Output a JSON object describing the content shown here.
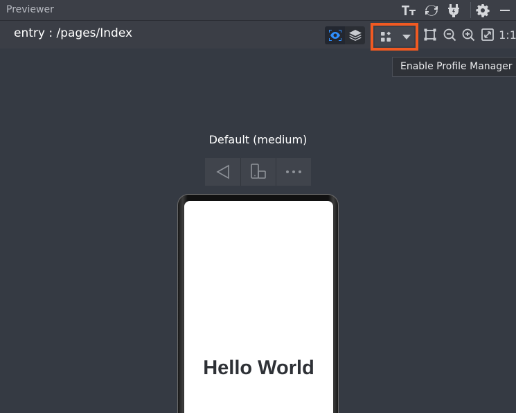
{
  "window": {
    "title": "Previewer"
  },
  "titlebar_icons": [
    "font-size-icon",
    "refresh-icon",
    "plug-icon",
    "gear-icon",
    "minimize-icon"
  ],
  "toolbar": {
    "path": "entry : /pages/Index",
    "view_toggle": [
      "eye-icon",
      "layers-icon"
    ],
    "profile_manager_icon": "grid-icon",
    "profile_dropdown_icon": "chevron-down-icon",
    "zoom_reset_label": "1:1"
  },
  "tooltip": {
    "text": "Enable Profile Manager"
  },
  "device": {
    "label": "Default (medium)",
    "controls": [
      "back-icon",
      "rotate-device-icon",
      "more-icon"
    ],
    "screen_text": "Hello World"
  },
  "colors": {
    "highlight": "#f15a22",
    "active_icon": "#2f8fff",
    "background": "#353a43"
  }
}
